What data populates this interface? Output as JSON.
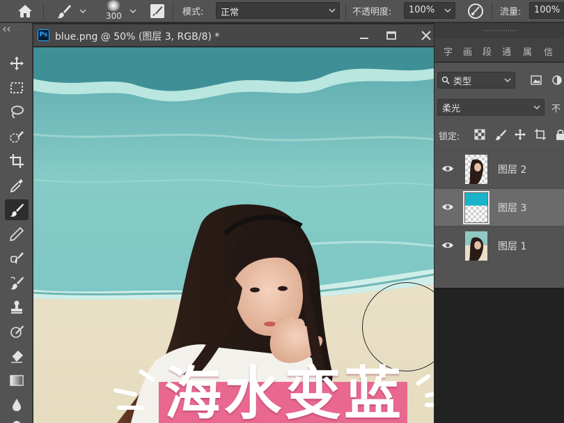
{
  "options_bar": {
    "brush_size": "300",
    "mode_label": "模式:",
    "mode_value": "正常",
    "opacity_label": "不透明度:",
    "opacity_value": "100%",
    "flow_label": "流量:",
    "flow_value": "100%"
  },
  "toolbar": {
    "tools": [
      "move-icon",
      "marquee-icon",
      "lasso-icon",
      "quick-select-icon",
      "crop-icon",
      "eyedropper-icon",
      "brush-icon",
      "pencil-icon",
      "healing-icon",
      "brush-history-icon",
      "stamp-icon",
      "smudge-icon",
      "eraser-icon",
      "gradient-icon",
      "blur-drop-icon",
      "dodge-icon"
    ],
    "active_tool": "brush-icon"
  },
  "document": {
    "title": "blue.png @ 50% (图层 3, RGB/8) *",
    "app_badge": "Ps",
    "caption": "海水变蓝",
    "caption_color": "#e86890"
  },
  "panels": {
    "tabs": [
      "字",
      "画",
      "段",
      "通",
      "属",
      "信"
    ],
    "filter_kind": "类型",
    "blend_mode": "柔光",
    "opacity_short": "不",
    "lock_label": "锁定:",
    "layers": [
      {
        "name": "图层 2",
        "visible": true,
        "selected": false
      },
      {
        "name": "图层 3",
        "visible": true,
        "selected": true
      },
      {
        "name": "图层 1",
        "visible": true,
        "selected": false
      }
    ],
    "footer_fx": "fx"
  },
  "colors": {
    "ui_panel": "#535353",
    "ui_dark": "#282828",
    "sea": "#7cc6c4",
    "accent_pink": "#e86890"
  }
}
